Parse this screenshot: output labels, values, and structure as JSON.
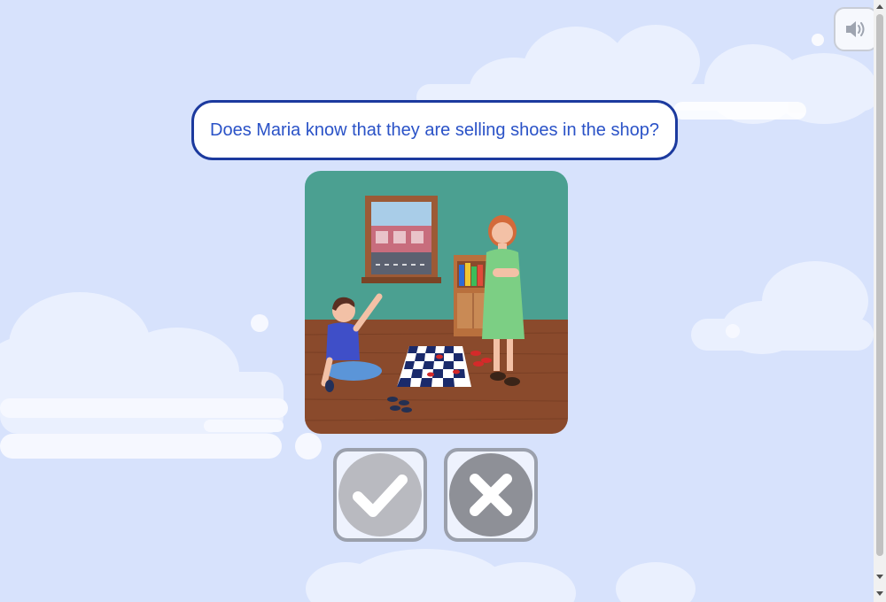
{
  "question": {
    "text": "Does Maria know that they are selling shoes in the shop?"
  },
  "illustration": {
    "description_icon": "children-playing-checkers-illustration"
  },
  "answers": {
    "yes_icon": "checkmark-icon",
    "no_icon": "cross-icon"
  },
  "sound": {
    "icon": "speaker-icon"
  },
  "colors": {
    "background": "#d7e2fc",
    "question_border": "#1c3a9e",
    "question_text": "#2a52c7",
    "wall": "#4fa596",
    "floor": "#8a4a2c"
  }
}
